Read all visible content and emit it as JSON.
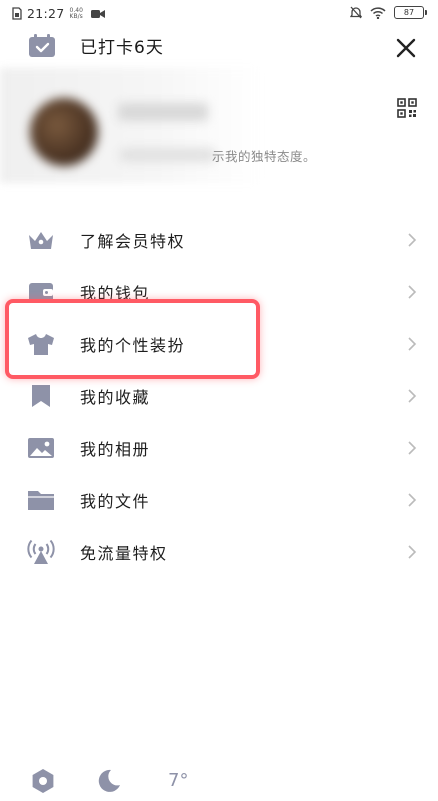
{
  "status_bar": {
    "time": "21:27",
    "net_speed": "0.40 KB/s",
    "battery": "87",
    "icons": [
      "sim-icon",
      "video-record-icon",
      "mute-icon",
      "wifi-icon",
      "battery-icon"
    ]
  },
  "header": {
    "checkin_label": "已打卡6天",
    "icons": [
      "calendar-check-icon",
      "close-icon"
    ]
  },
  "profile": {
    "signature_text": "示我的独特态度。",
    "icons": [
      "qr-code-icon"
    ]
  },
  "menu": {
    "items": [
      {
        "label": "了解会员特权",
        "icon": "crown-icon"
      },
      {
        "label": "我的钱包",
        "icon": "wallet-icon"
      },
      {
        "label": "我的个性装扮",
        "icon": "tshirt-icon"
      },
      {
        "label": "我的收藏",
        "icon": "bookmark-icon"
      },
      {
        "label": "我的相册",
        "icon": "image-icon"
      },
      {
        "label": "我的文件",
        "icon": "folder-icon"
      },
      {
        "label": "免流量特权",
        "icon": "signal-tower-icon"
      }
    ],
    "highlighted_index": 2
  },
  "bottom_bar": {
    "weather": "7°",
    "icons": [
      "settings-icon",
      "night-mode-icon"
    ]
  },
  "colors": {
    "icon_gray": "#8e92a8",
    "highlight": "#ff5a64",
    "text": "#1e1e1e",
    "signature": "#8a8a8a"
  }
}
